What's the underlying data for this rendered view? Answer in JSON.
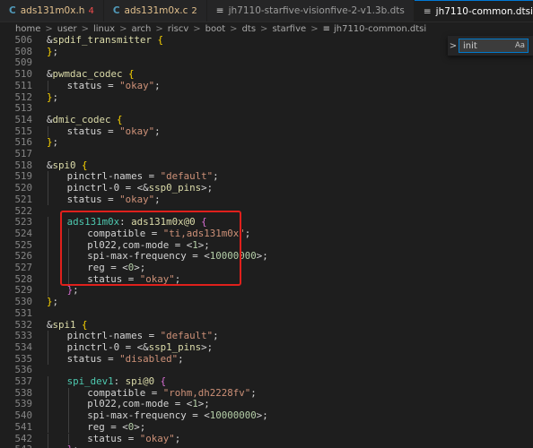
{
  "tabs": [
    {
      "icon": "C",
      "title": "ads131m0x.h",
      "badge": "4",
      "active": false
    },
    {
      "icon": "C",
      "title": "ads131m0x.c",
      "badge": "2",
      "active": false
    },
    {
      "icon": "≡",
      "title": "jh7110-starfive-visionfive-2-v1.3b.dts",
      "badge": "",
      "active": false
    },
    {
      "icon": "≡",
      "title": "jh7110-common.dtsi",
      "badge": "",
      "active": true,
      "close": "×"
    },
    {
      "icon": "≡",
      "title": "jh7110.dtsi",
      "badge": "",
      "active": false
    }
  ],
  "breadcrumb": [
    "home",
    "user",
    "linux",
    "arch",
    "riscv",
    "boot",
    "dts",
    "starfive",
    "jh7110-common.dtsi"
  ],
  "breadcrumb_sep": ">",
  "breadcrumb_file_icon": "≡",
  "find": {
    "value": "init",
    "case_toggle": "Aa",
    "arrow": ">"
  },
  "lines": [
    {
      "n": "506",
      "indent": 0,
      "segs": [
        [
          "amp",
          "&"
        ],
        [
          "node",
          "spdif_transmitter"
        ],
        [
          "prop",
          " "
        ],
        [
          "brace",
          "{"
        ]
      ]
    },
    {
      "n": "508",
      "indent": 0,
      "segs": [
        [
          "brace",
          "}"
        ],
        [
          "prop",
          ";"
        ]
      ]
    },
    {
      "n": "509",
      "indent": 0,
      "segs": []
    },
    {
      "n": "510",
      "indent": 0,
      "segs": [
        [
          "amp",
          "&"
        ],
        [
          "node",
          "pwmdac_codec"
        ],
        [
          "prop",
          " "
        ],
        [
          "brace",
          "{"
        ]
      ]
    },
    {
      "n": "511",
      "indent": 1,
      "segs": [
        [
          "prop",
          "status = "
        ],
        [
          "str",
          "\"okay\""
        ],
        [
          "prop",
          ";"
        ]
      ]
    },
    {
      "n": "512",
      "indent": 0,
      "segs": [
        [
          "brace",
          "}"
        ],
        [
          "prop",
          ";"
        ]
      ]
    },
    {
      "n": "513",
      "indent": 0,
      "segs": []
    },
    {
      "n": "514",
      "indent": 0,
      "segs": [
        [
          "amp",
          "&"
        ],
        [
          "node",
          "dmic_codec"
        ],
        [
          "prop",
          " "
        ],
        [
          "brace",
          "{"
        ]
      ]
    },
    {
      "n": "515",
      "indent": 1,
      "segs": [
        [
          "prop",
          "status = "
        ],
        [
          "str",
          "\"okay\""
        ],
        [
          "prop",
          ";"
        ]
      ]
    },
    {
      "n": "516",
      "indent": 0,
      "segs": [
        [
          "brace",
          "}"
        ],
        [
          "prop",
          ";"
        ]
      ]
    },
    {
      "n": "517",
      "indent": 0,
      "segs": []
    },
    {
      "n": "518",
      "indent": 0,
      "segs": [
        [
          "amp",
          "&"
        ],
        [
          "node",
          "spi0"
        ],
        [
          "prop",
          " "
        ],
        [
          "brace",
          "{"
        ]
      ]
    },
    {
      "n": "519",
      "indent": 1,
      "segs": [
        [
          "prop",
          "pinctrl-names = "
        ],
        [
          "str",
          "\"default\""
        ],
        [
          "prop",
          ";"
        ]
      ]
    },
    {
      "n": "520",
      "indent": 1,
      "segs": [
        [
          "prop",
          "pinctrl-0 = <&"
        ],
        [
          "node",
          "ssp0_pins"
        ],
        [
          "prop",
          ">;"
        ]
      ]
    },
    {
      "n": "521",
      "indent": 1,
      "segs": [
        [
          "prop",
          "status = "
        ],
        [
          "str",
          "\"okay\""
        ],
        [
          "prop",
          ";"
        ]
      ]
    },
    {
      "n": "522",
      "indent": 0,
      "segs": []
    },
    {
      "n": "523",
      "indent": 1,
      "segs": [
        [
          "label",
          "ads131m0x"
        ],
        [
          "prop",
          ": "
        ],
        [
          "node",
          "ads131m0x@0"
        ],
        [
          "prop",
          " "
        ],
        [
          "brace2",
          "{"
        ]
      ]
    },
    {
      "n": "524",
      "indent": 2,
      "segs": [
        [
          "prop",
          "compatible = "
        ],
        [
          "str",
          "\"ti,ads131m0x\""
        ],
        [
          "prop",
          ";"
        ]
      ]
    },
    {
      "n": "525",
      "indent": 2,
      "segs": [
        [
          "prop",
          "pl022,com-mode = <"
        ],
        [
          "num",
          "1"
        ],
        [
          "prop",
          ">;"
        ]
      ]
    },
    {
      "n": "526",
      "indent": 2,
      "segs": [
        [
          "prop",
          "spi-max-frequency = <"
        ],
        [
          "num",
          "10000000"
        ],
        [
          "prop",
          ">;"
        ]
      ]
    },
    {
      "n": "527",
      "indent": 2,
      "segs": [
        [
          "prop",
          "reg = <"
        ],
        [
          "num",
          "0"
        ],
        [
          "prop",
          ">;"
        ]
      ]
    },
    {
      "n": "528",
      "indent": 2,
      "segs": [
        [
          "prop",
          "status = "
        ],
        [
          "str",
          "\"okay\""
        ],
        [
          "prop",
          ";"
        ]
      ]
    },
    {
      "n": "529",
      "indent": 1,
      "segs": [
        [
          "brace2",
          "}"
        ],
        [
          "prop",
          ";"
        ]
      ]
    },
    {
      "n": "530",
      "indent": 0,
      "segs": [
        [
          "brace",
          "}"
        ],
        [
          "prop",
          ";"
        ]
      ]
    },
    {
      "n": "531",
      "indent": 0,
      "segs": []
    },
    {
      "n": "532",
      "indent": 0,
      "segs": [
        [
          "amp",
          "&"
        ],
        [
          "node",
          "spi1"
        ],
        [
          "prop",
          " "
        ],
        [
          "brace",
          "{"
        ]
      ]
    },
    {
      "n": "533",
      "indent": 1,
      "segs": [
        [
          "prop",
          "pinctrl-names = "
        ],
        [
          "str",
          "\"default\""
        ],
        [
          "prop",
          ";"
        ]
      ]
    },
    {
      "n": "534",
      "indent": 1,
      "segs": [
        [
          "prop",
          "pinctrl-0 = <&"
        ],
        [
          "node",
          "ssp1_pins"
        ],
        [
          "prop",
          ">;"
        ]
      ]
    },
    {
      "n": "535",
      "indent": 1,
      "segs": [
        [
          "prop",
          "status = "
        ],
        [
          "str",
          "\"disabled\""
        ],
        [
          "prop",
          ";"
        ]
      ]
    },
    {
      "n": "536",
      "indent": 0,
      "segs": []
    },
    {
      "n": "537",
      "indent": 1,
      "segs": [
        [
          "label",
          "spi_dev1"
        ],
        [
          "prop",
          ": "
        ],
        [
          "node",
          "spi@0"
        ],
        [
          "prop",
          " "
        ],
        [
          "brace2",
          "{"
        ]
      ]
    },
    {
      "n": "538",
      "indent": 2,
      "segs": [
        [
          "prop",
          "compatible = "
        ],
        [
          "str",
          "\"rohm,dh2228fv\""
        ],
        [
          "prop",
          ";"
        ]
      ]
    },
    {
      "n": "539",
      "indent": 2,
      "segs": [
        [
          "prop",
          "pl022,com-mode = <"
        ],
        [
          "num",
          "1"
        ],
        [
          "prop",
          ">;"
        ]
      ]
    },
    {
      "n": "540",
      "indent": 2,
      "segs": [
        [
          "prop",
          "spi-max-frequency = <"
        ],
        [
          "num",
          "10000000"
        ],
        [
          "prop",
          ">;"
        ]
      ]
    },
    {
      "n": "541",
      "indent": 2,
      "segs": [
        [
          "prop",
          "reg = <"
        ],
        [
          "num",
          "0"
        ],
        [
          "prop",
          ">;"
        ]
      ]
    },
    {
      "n": "542",
      "indent": 2,
      "segs": [
        [
          "prop",
          "status = "
        ],
        [
          "str",
          "\"okay\""
        ],
        [
          "prop",
          ";"
        ]
      ]
    },
    {
      "n": "543",
      "indent": 1,
      "segs": [
        [
          "brace2",
          "}"
        ],
        [
          "prop",
          ";"
        ]
      ]
    }
  ]
}
